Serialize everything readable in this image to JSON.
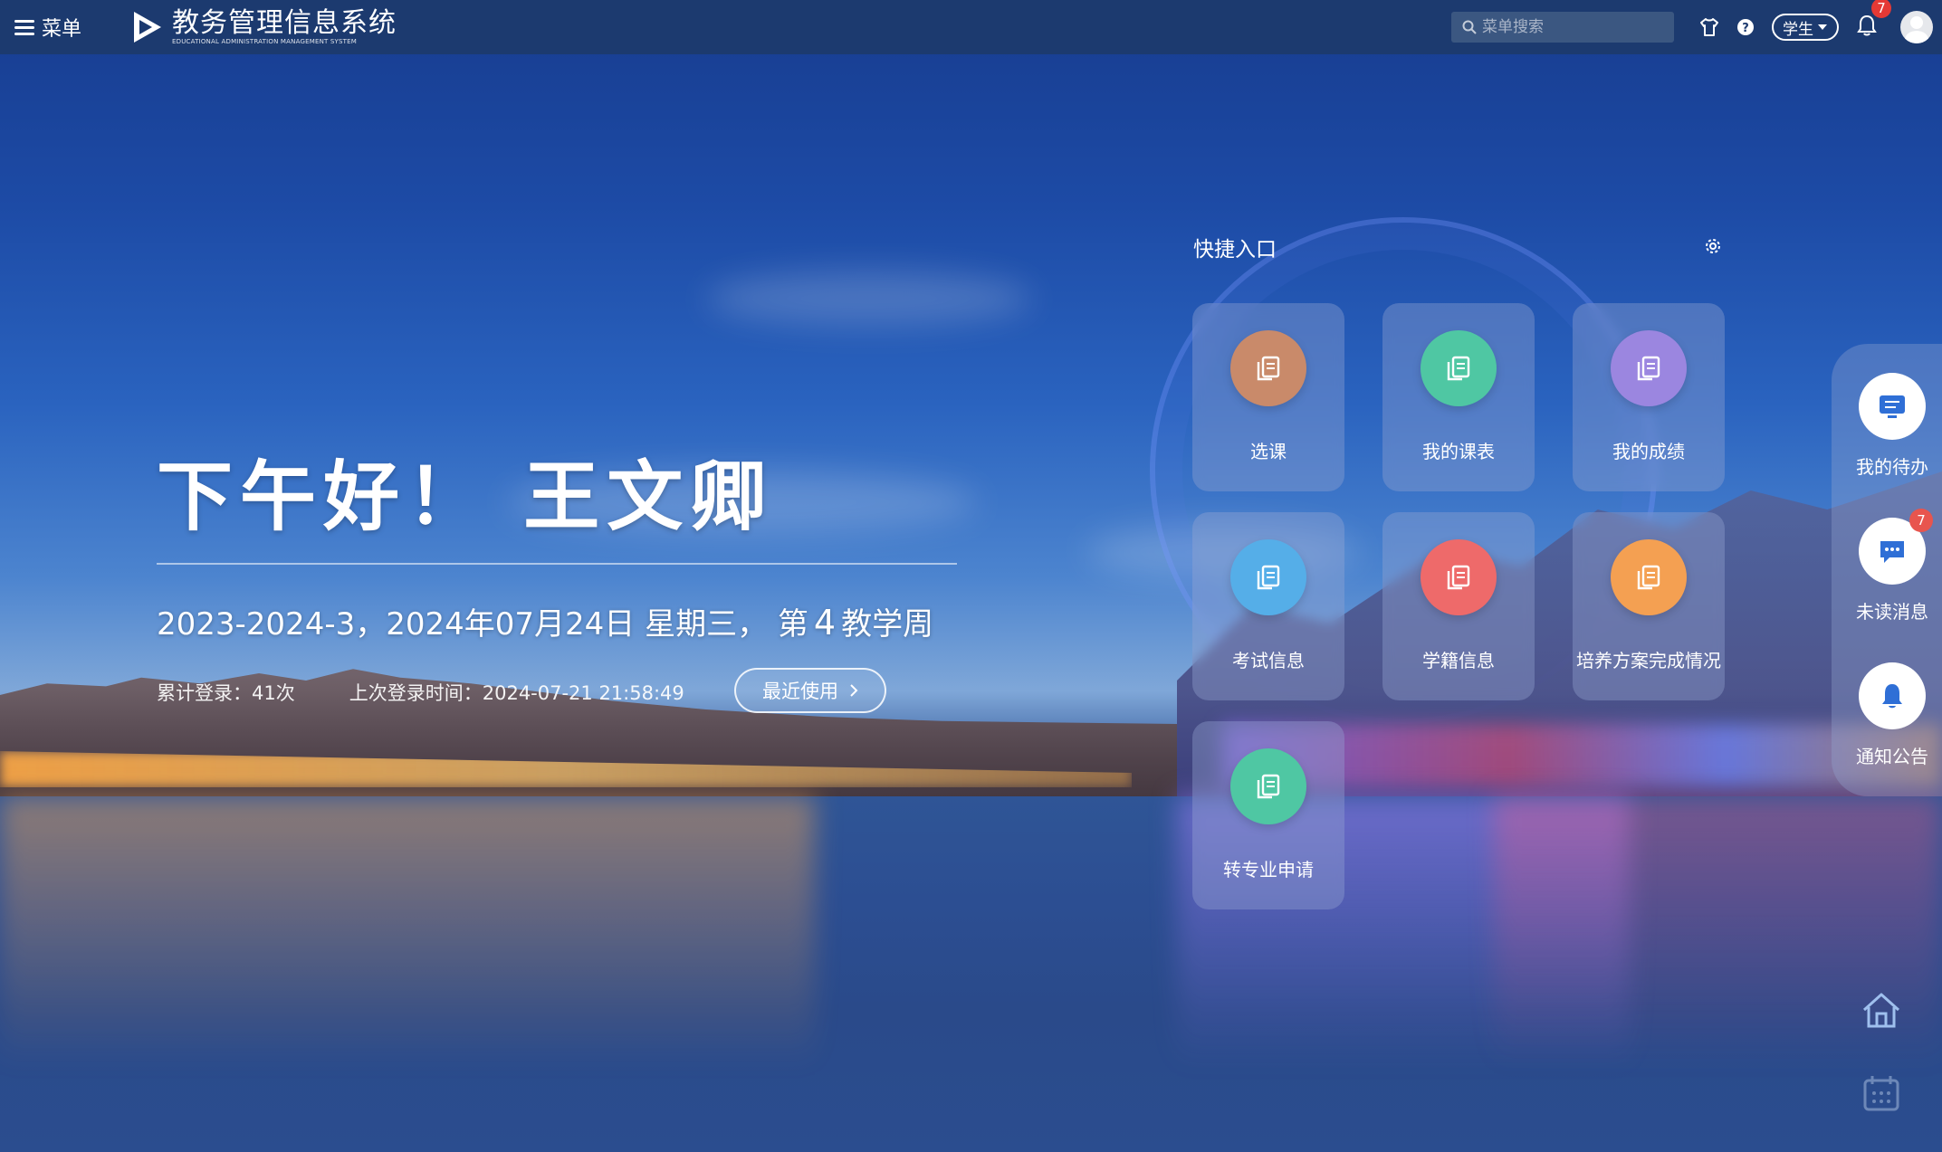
{
  "topbar": {
    "menu_label": "菜单",
    "system_name": "教务管理信息系统",
    "system_name_en": "EDUCATIONAL ADMINISTRATION MANAGEMENT SYSTEM",
    "search_placeholder": "菜单搜索",
    "role": "学生",
    "notification_count": "7"
  },
  "greeting": {
    "text": "下午好！ 王文卿",
    "term": "2023-2024-3，2024年07月24日 星期三，",
    "week_prefix": "第",
    "week_number": "4",
    "week_suffix": "教学周",
    "login_count": "累计登录：41次",
    "last_login": "上次登录时间：2024-07-21 21:58:49",
    "recent_button": "最近使用"
  },
  "quick_entry": {
    "title": "快捷入口",
    "tiles": [
      {
        "label": "选课",
        "color": "#c98a6a"
      },
      {
        "label": "我的课表",
        "color": "#4fc7a3"
      },
      {
        "label": "我的成绩",
        "color": "#9b86e0"
      },
      {
        "label": "考试信息",
        "color": "#55aee8"
      },
      {
        "label": "学籍信息",
        "color": "#ee6a6a"
      },
      {
        "label": "培养方案完成情况",
        "color": "#f4a052"
      },
      {
        "label": "转专业申请",
        "color": "#4fc7a3"
      }
    ]
  },
  "side_panel": {
    "items": [
      {
        "label": "我的待办",
        "icon": "todo-screen-icon"
      },
      {
        "label": "未读消息",
        "icon": "chat-bubble-icon",
        "badge": "7"
      },
      {
        "label": "通知公告",
        "icon": "bell-icon"
      }
    ]
  },
  "colors": {
    "topbar": "#1c3a6f",
    "accent_blue": "#2f6fd6"
  }
}
